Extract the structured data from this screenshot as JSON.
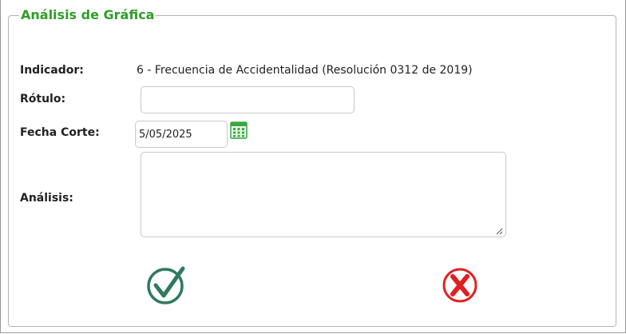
{
  "panel": {
    "legend": "Análisis de Gráfica"
  },
  "form": {
    "indicador": {
      "label": "Indicador:",
      "value": "6 - Frecuencia de Accidentalidad (Resolución 0312 de 2019)"
    },
    "rotulo": {
      "label": "Rótulo:",
      "value": "",
      "placeholder": ""
    },
    "fecha_corte": {
      "label": "Fecha Corte:",
      "value": "5/05/2025"
    },
    "analisis": {
      "label": "Análisis:",
      "value": ""
    }
  },
  "icons": {
    "calendar": "calendar-icon",
    "confirm": "check-circle-icon",
    "cancel": "x-circle-icon"
  },
  "colors": {
    "legend": "#2e9e28",
    "confirm": "#2f7a5e",
    "cancel": "#e02020",
    "calendar": "#39a845"
  }
}
